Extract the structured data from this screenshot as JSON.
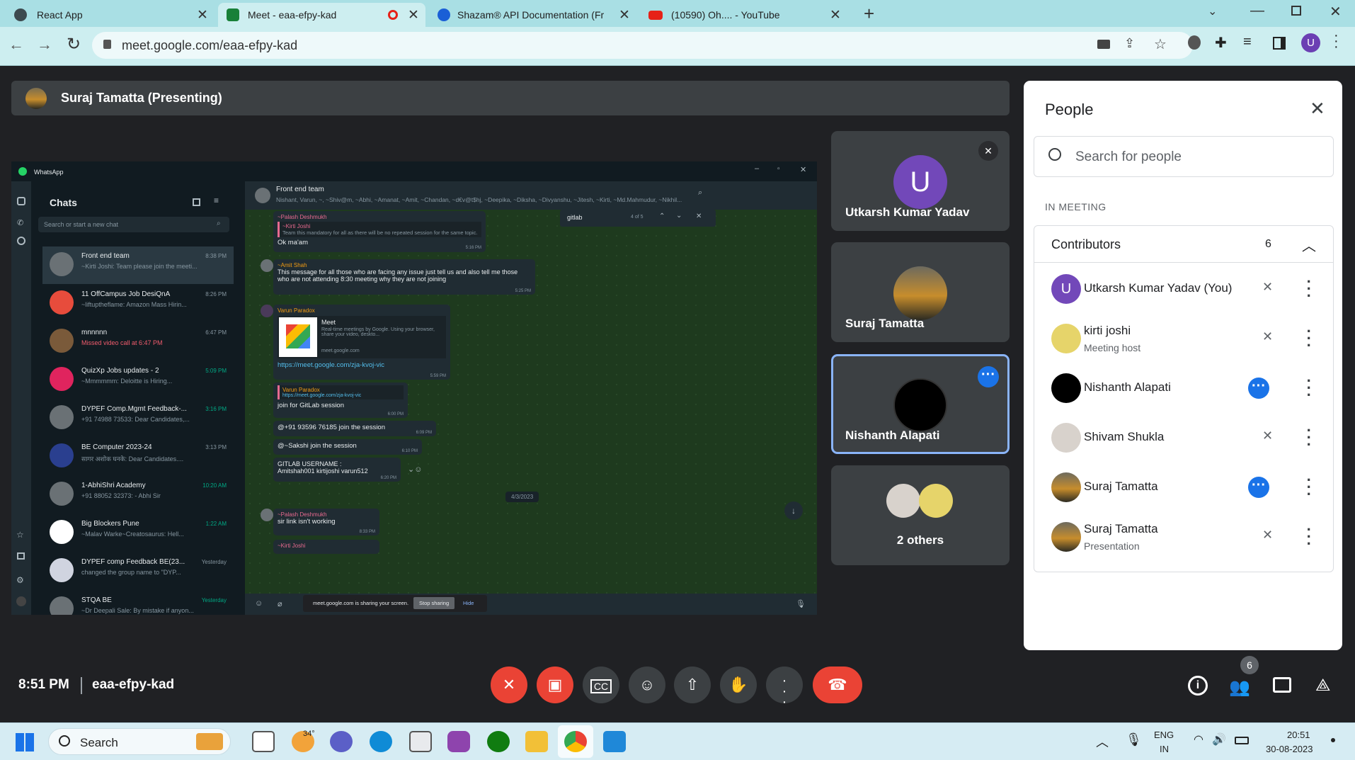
{
  "browser": {
    "tabs": [
      {
        "title": "React App",
        "color": "#3d4a4f"
      },
      {
        "title": "Meet - eaa-efpy-kad",
        "color": "#188038"
      },
      {
        "title": "Shazam® API Documentation (Fr",
        "color": "#1a5fd6"
      },
      {
        "title": "(10590) Oh.... - YouTube",
        "color": "#e62117"
      }
    ],
    "url": "meet.google.com/eaa-efpy-kad",
    "profile_initial": "U"
  },
  "meet": {
    "presenter_label": "Suraj Tamatta (Presenting)",
    "time": "8:51 PM",
    "code": "eaa-efpy-kad",
    "participants_count": "6",
    "tiles": [
      {
        "name": "Utkarsh Kumar Yadav",
        "initial": "U"
      },
      {
        "name": "Suraj Tamatta"
      },
      {
        "name": "Nishanth Alapati"
      },
      {
        "name": "2 others"
      }
    ]
  },
  "people_panel": {
    "title": "People",
    "search_placeholder": "Search for people",
    "section_label": "IN MEETING",
    "group_label": "Contributors",
    "group_count": "6",
    "people": [
      {
        "name": "Utkarsh Kumar Yadav (You)",
        "sub": "",
        "initial": "U"
      },
      {
        "name": "kirti joshi",
        "sub": "Meeting host"
      },
      {
        "name": "Nishanth Alapati",
        "sub": ""
      },
      {
        "name": "Shivam Shukla",
        "sub": ""
      },
      {
        "name": "Suraj Tamatta",
        "sub": ""
      },
      {
        "name": "Suraj Tamatta",
        "sub": "Presentation"
      }
    ]
  },
  "whatsapp": {
    "app": "WhatsApp",
    "chats_title": "Chats",
    "search_placeholder": "Search or start a new chat",
    "chats": [
      {
        "name": "Front end team",
        "msg": "~Kirti Joshi: Team please join the meeti...",
        "time": "8:38 PM"
      },
      {
        "name": "11 OffCampus Job DesiQnA",
        "msg": "~liftuptheflame: Amazon Mass Hirin...",
        "time": "8:26 PM"
      },
      {
        "name": "mnnnnn",
        "msg": "Missed video call at 6:47 PM",
        "time": "6:47 PM"
      },
      {
        "name": "QuizXp Jobs updates - 2",
        "msg": "~Mmmmmm: Deloitte is Hiring...",
        "time": "5:09 PM"
      },
      {
        "name": "DYPEF Comp.Mgmt Feedback-...",
        "msg": "+91 74988 73533: Dear Candidates,...",
        "time": "3:16 PM"
      },
      {
        "name": "BE Computer 2023-24",
        "msg": "सागर अशोक घनके: Dear Candidates....",
        "time": "3:13 PM"
      },
      {
        "name": "1-AbhiShri Academy",
        "msg": "+91 88052 32373: - Abhi Sir",
        "time": "10:20 AM"
      },
      {
        "name": "Big Blockers Pune",
        "msg": "~Malav Warke~Creatosaurus: Hell...",
        "time": "1:22 AM"
      },
      {
        "name": "DYPEF comp Feedback BE(23...",
        "msg": "changed the group name to \"DYP...",
        "time": "Yesterday"
      },
      {
        "name": "STQA BE",
        "msg": "~Dr Deepali Sale: By mistake if anyon...",
        "time": "Yesterday"
      }
    ],
    "group_name": "Front end team",
    "group_members": "Nishant, Varun, ~, ~Shiv@m, ~Abhi, ~Amanat, ~Amit, ~Chandan, ~d€v@t$hj, ~Deepika, ~Diksha, ~Divyanshu, ~Jitesh, ~Kirti, ~Md.Mahmudur, ~Nikhil...",
    "find_text": "gitlab",
    "find_count": "4 of 5",
    "messages": [
      {
        "sender": "~Palash Deshmukh",
        "quote_author": "~Kirti Joshi",
        "quote": "Team this mandatory for all as there will be no repeated session for the same topic.",
        "text": "Ok ma'am",
        "time": "5:16 PM"
      },
      {
        "sender": "~Amit Shah",
        "text": "This message for all those who are facing any issue just tell us and also tell me those who are not attending 8:30 meeting why they are not joining",
        "time": "5:25 PM"
      },
      {
        "sender": "Varun Paradox",
        "link_title": "Meet",
        "link_desc": "Real-time meetings by Google. Using your browser, share your video, deskto...",
        "link_domain": "meet.google.com",
        "text": "https://meet.google.com/zja-kvoj-vic",
        "time": "5:59 PM"
      },
      {
        "quote_author": "Varun Paradox",
        "quote": "https://meet.google.com/zja-kvoj-vic",
        "text": "join for GitLab session",
        "time": "6:00 PM"
      },
      {
        "text": "@+91 93596 76185 join the session",
        "time": "6:09 PM"
      },
      {
        "text": "@~Sakshi join the session",
        "time": "6:10 PM"
      },
      {
        "text": "GITLAB USERNAME : Amitshah001 kirtijoshi varun512",
        "time": "6:20 PM"
      },
      {
        "date": "4/3/2023"
      },
      {
        "sender": "~Palash Deshmukh",
        "text": "sir link isn't working",
        "time": "8:33 PM"
      },
      {
        "sender": "~Kirti Joshi",
        "text": "",
        "time": ""
      }
    ],
    "sharing_notice": "meet.google.com is sharing your screen.",
    "stop_sharing": "Stop sharing",
    "hide": "Hide"
  },
  "taskbar": {
    "search": "Search",
    "weather": "34°",
    "lang": "ENG",
    "region": "IN",
    "clock_time": "20:51",
    "clock_date": "30-08-2023"
  }
}
